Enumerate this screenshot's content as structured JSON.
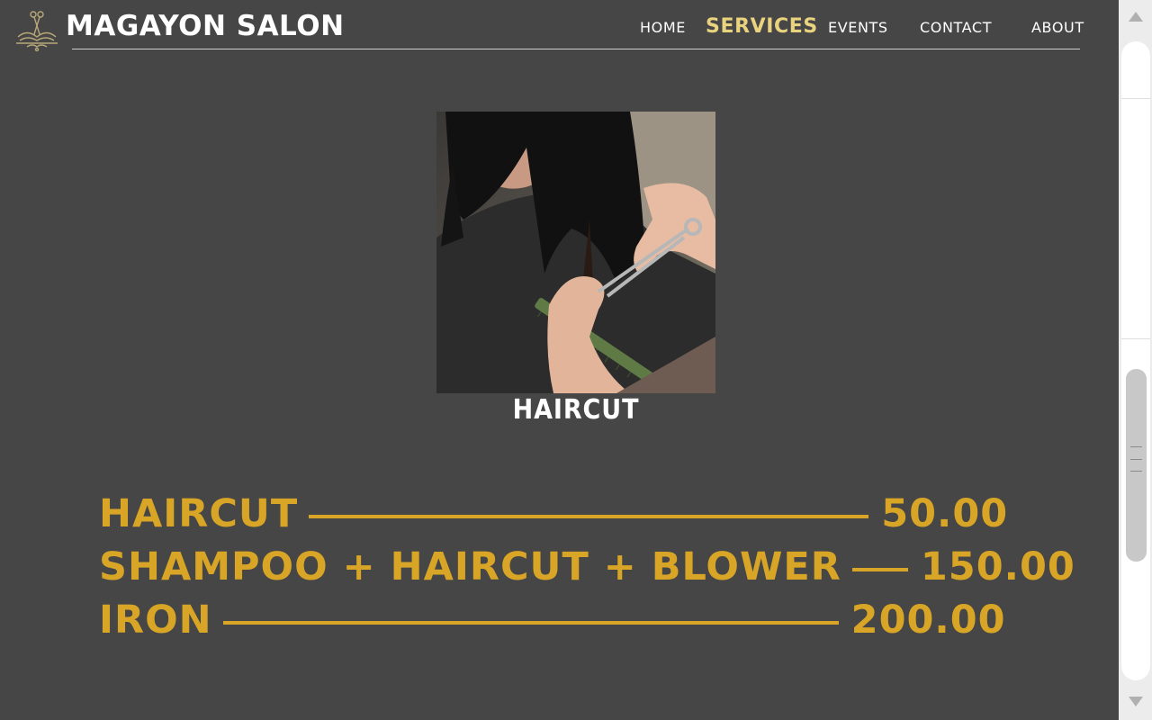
{
  "header": {
    "brand": "MAGAYON SALON",
    "logo_icon": "salon-scissors-crest-icon"
  },
  "nav": {
    "items": [
      {
        "label": "HOME",
        "active": false
      },
      {
        "label": "SERVICES",
        "active": true
      },
      {
        "label": "EVENTS",
        "active": false
      },
      {
        "label": "CONTACT",
        "active": false
      },
      {
        "label": "ABOUT",
        "active": false
      }
    ]
  },
  "service": {
    "title": "HAIRCUT",
    "image": "photo of stylist cutting hair with comb and scissors"
  },
  "prices": [
    {
      "name": "HAIRCUT",
      "price": "50.00"
    },
    {
      "name": "SHAMPOO + HAIRCUT + BLOWER",
      "price": "150.00"
    },
    {
      "name": "IRON",
      "price": "200.00"
    }
  ],
  "colors": {
    "background": "#464646",
    "accent_gold": "#d9a526",
    "nav_active": "#e9d37f",
    "text": "#ffffff"
  }
}
